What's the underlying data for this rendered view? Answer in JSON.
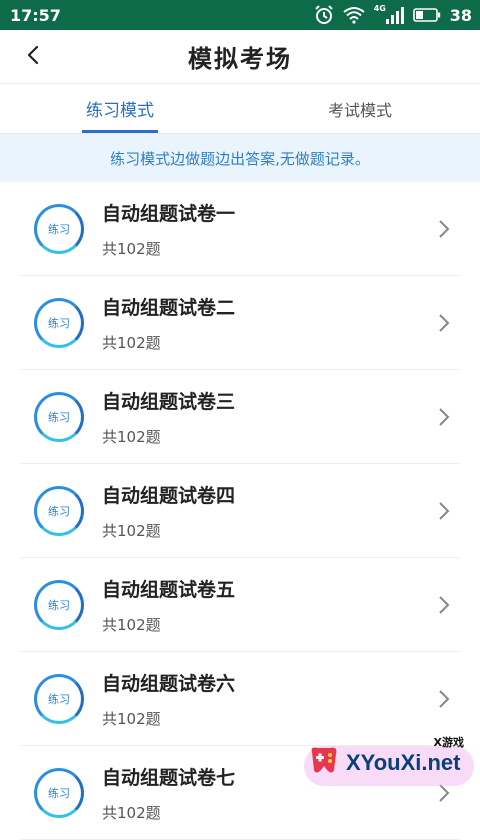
{
  "status_bar": {
    "time": "17:57",
    "network": "4G",
    "battery": "38"
  },
  "nav": {
    "title": "模拟考场",
    "back_icon": "chevron-left-icon"
  },
  "tabs": [
    {
      "label": "练习模式",
      "active": true
    },
    {
      "label": "考试模式",
      "active": false
    }
  ],
  "notice": "练习模式边做题边出答案,无做题记录。",
  "papers": [
    {
      "badge": "练习",
      "title": "自动组题试卷一",
      "count": "共102题"
    },
    {
      "badge": "练习",
      "title": "自动组题试卷二",
      "count": "共102题"
    },
    {
      "badge": "练习",
      "title": "自动组题试卷三",
      "count": "共102题"
    },
    {
      "badge": "练习",
      "title": "自动组题试卷四",
      "count": "共102题"
    },
    {
      "badge": "练习",
      "title": "自动组题试卷五",
      "count": "共102题"
    },
    {
      "badge": "练习",
      "title": "自动组题试卷六",
      "count": "共102题"
    },
    {
      "badge": "练习",
      "title": "自动组题试卷七",
      "count": "共102题"
    }
  ],
  "watermark": {
    "small": "X游戏",
    "big": "XYouXi.net"
  },
  "colors": {
    "status_bar": "#0d6b4a",
    "accent": "#2a6fc2",
    "notice_bg": "#eaf4fc"
  }
}
